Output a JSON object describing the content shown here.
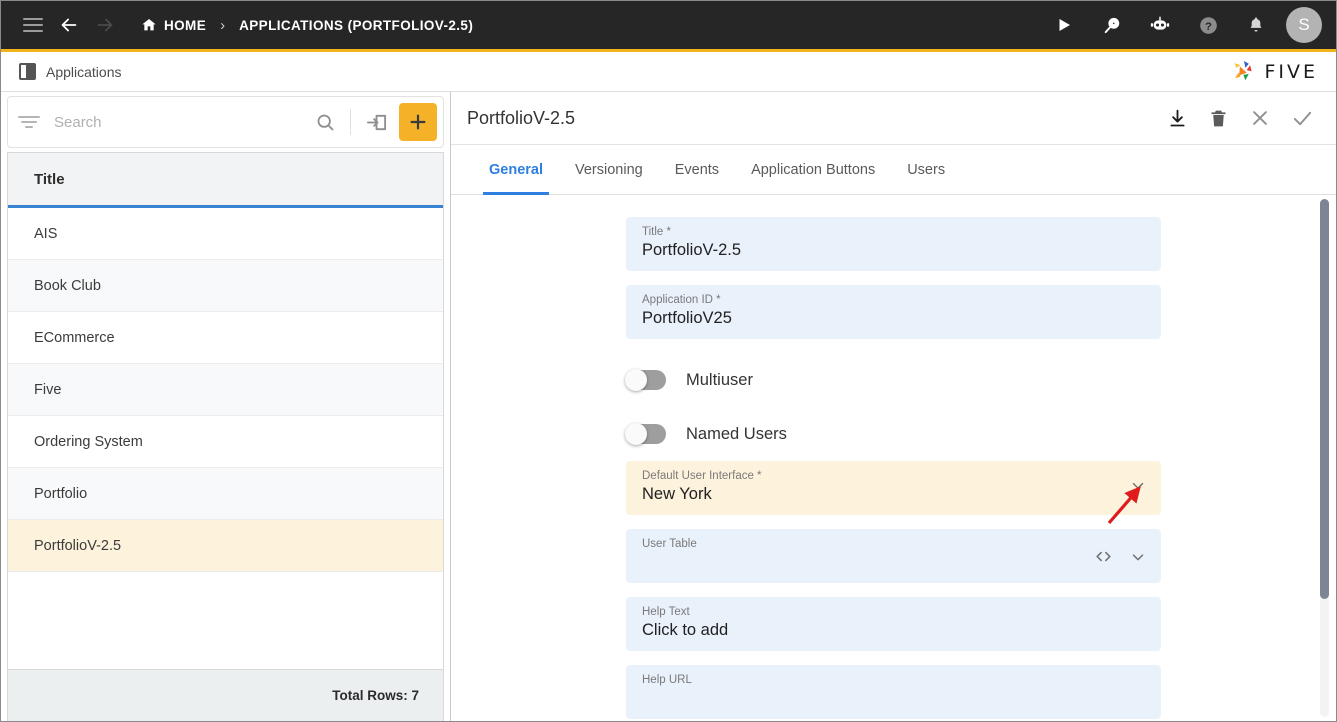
{
  "topbar": {
    "menu_icon": "hamburger-icon",
    "back_icon": "arrow-left-icon",
    "forward_icon": "arrow-right-icon",
    "home_label": "HOME",
    "separator": "›",
    "current_label": "APPLICATIONS (PORTFOLIOV-2.5)",
    "icons": [
      "play-icon",
      "search-play-icon",
      "robot-icon",
      "help-icon",
      "bell-icon"
    ],
    "avatar_initial": "S",
    "accent_color": "#f2b21b",
    "background_color": "#262626"
  },
  "subheader": {
    "tab_label": "Applications",
    "brand_text": "FIVE"
  },
  "sidebar": {
    "search": {
      "placeholder": "Search",
      "filter_icon": "filter-icon",
      "search_icon": "search-icon",
      "import_icon": "import-icon",
      "add_label": "+"
    },
    "grid": {
      "columns": [
        "Title"
      ],
      "rows": [
        {
          "title": "AIS",
          "selected": false
        },
        {
          "title": "Book Club",
          "selected": false
        },
        {
          "title": "ECommerce",
          "selected": false
        },
        {
          "title": "Five",
          "selected": false
        },
        {
          "title": "Ordering System",
          "selected": false
        },
        {
          "title": "Portfolio",
          "selected": false
        },
        {
          "title": "PortfolioV-2.5",
          "selected": true
        }
      ],
      "footer": "Total Rows: 7"
    }
  },
  "detail": {
    "title": "PortfolioV-2.5",
    "actions": [
      "download-icon",
      "delete-icon",
      "close-icon",
      "confirm-icon"
    ],
    "tabs": [
      {
        "label": "General",
        "active": true
      },
      {
        "label": "Versioning",
        "active": false
      },
      {
        "label": "Events",
        "active": false
      },
      {
        "label": "Application Buttons",
        "active": false
      },
      {
        "label": "Users",
        "active": false
      }
    ],
    "fields": [
      {
        "label": "Title",
        "required": true,
        "value": "PortfolioV-2.5",
        "modified": false,
        "icons": []
      },
      {
        "label": "Application ID",
        "required": true,
        "value": "PortfolioV25",
        "modified": false,
        "icons": []
      },
      {
        "label": "Default User Interface",
        "required": true,
        "value": "New York",
        "modified": true,
        "icons": [
          "chevron-down-icon"
        ]
      },
      {
        "label": "User Table",
        "required": false,
        "value": "",
        "modified": false,
        "icons": [
          "code-icon",
          "chevron-down-icon"
        ]
      },
      {
        "label": "Help Text",
        "required": false,
        "value": "Click to add",
        "modified": false,
        "icons": []
      },
      {
        "label": "Help URL",
        "required": false,
        "value": "",
        "modified": false,
        "icons": []
      }
    ],
    "toggles": [
      {
        "label": "Multiuser",
        "on": false
      },
      {
        "label": "Named Users",
        "on": false
      }
    ]
  },
  "annotation": {
    "type": "arrow",
    "color": "#e01b1b",
    "points_at": "default-user-interface-chevron"
  }
}
